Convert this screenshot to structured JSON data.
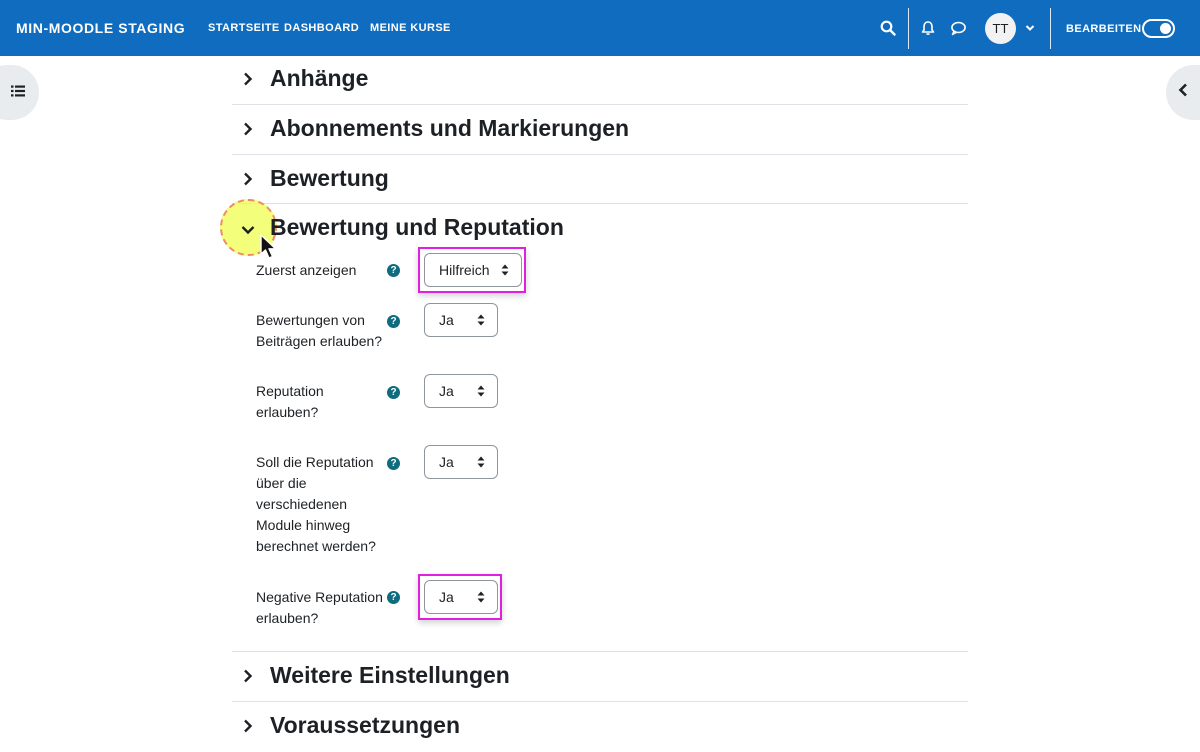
{
  "navbar": {
    "brand": "MIN-MOODLE STAGING",
    "links": [
      "STARTSEITE",
      "DASHBOARD",
      "MEINE KURSE"
    ],
    "avatar_initials": "TT",
    "edit_mode_label": "BEARBEITEN",
    "edit_mode_on": true,
    "color": "#0f6cbf"
  },
  "sections": {
    "anhaenge": "Anhänge",
    "abonnements": "Abonnements und Markierungen",
    "bewertung": "Bewertung",
    "bewertung_reputation": "Bewertung und Reputation",
    "weitere": "Weitere Einstellungen",
    "voraussetzungen": "Voraussetzungen"
  },
  "form": {
    "rows": [
      {
        "label": "Zuerst anzeigen",
        "value": "Hilfreich"
      },
      {
        "label": "Bewertungen von Beiträgen erlauben?",
        "value": "Ja"
      },
      {
        "label": "Reputation erlauben?",
        "value": "Ja"
      },
      {
        "label": "Soll die Reputation über die verschiedenen Module hinweg berechnet werden?",
        "value": "Ja"
      },
      {
        "label": "Negative Reputation erlauben?",
        "value": "Ja"
      }
    ],
    "help_glyph": "?"
  },
  "icons": {
    "search": "search-icon",
    "bell": "bell-icon",
    "chat": "chat-icon",
    "course_index": "list-icon",
    "block_drawer": "chevron-left-icon"
  },
  "colors": {
    "highlight": "#e020e0",
    "help_icon": "#0f6b7e"
  }
}
